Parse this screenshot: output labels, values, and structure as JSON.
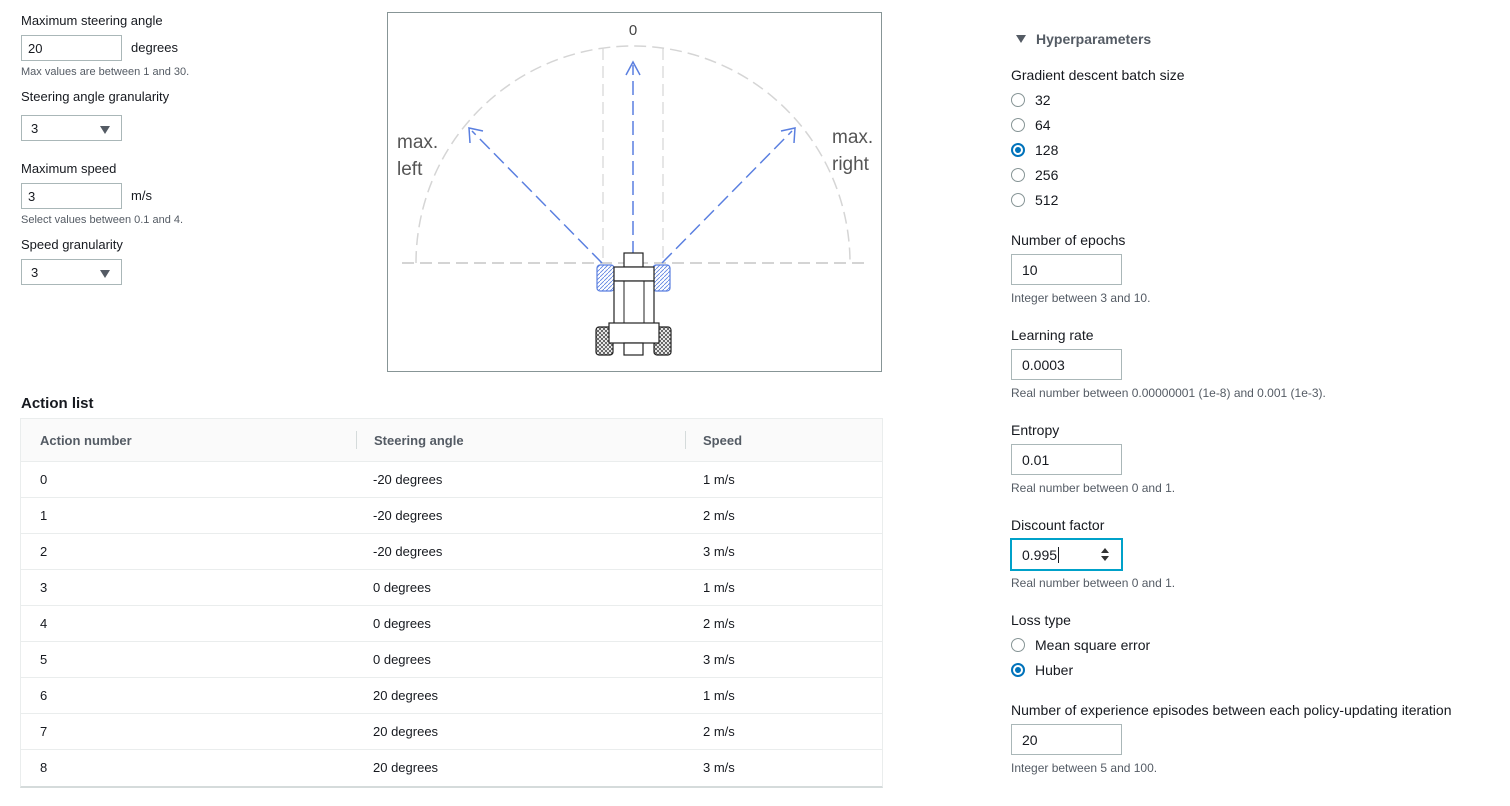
{
  "left_panel": {
    "max_steering_label": "Maximum steering angle",
    "max_steering_value": "20",
    "max_steering_unit": "degrees",
    "max_steering_hint": "Max values are between 1 and 30.",
    "steering_granularity_label": "Steering angle granularity",
    "steering_granularity_value": "3",
    "max_speed_label": "Maximum speed",
    "max_speed_value": "3",
    "max_speed_unit": "m/s",
    "max_speed_hint": "Select values between 0.1 and 4.",
    "speed_granularity_label": "Speed granularity",
    "speed_granularity_value": "3"
  },
  "diagram": {
    "top_label": "0",
    "left_label_1": "max.",
    "left_label_2": "left",
    "right_label_1": "max.",
    "right_label_2": "right",
    "arrow_color": "#5a7fe0"
  },
  "action_list": {
    "title": "Action list",
    "columns": [
      "Action number",
      "Steering angle",
      "Speed"
    ],
    "rows": [
      {
        "num": "0",
        "angle": "-20 degrees",
        "speed": "1 m/s"
      },
      {
        "num": "1",
        "angle": "-20 degrees",
        "speed": "2 m/s"
      },
      {
        "num": "2",
        "angle": "-20 degrees",
        "speed": "3 m/s"
      },
      {
        "num": "3",
        "angle": "0 degrees",
        "speed": "1 m/s"
      },
      {
        "num": "4",
        "angle": "0 degrees",
        "speed": "2 m/s"
      },
      {
        "num": "5",
        "angle": "0 degrees",
        "speed": "3 m/s"
      },
      {
        "num": "6",
        "angle": "20 degrees",
        "speed": "1 m/s"
      },
      {
        "num": "7",
        "angle": "20 degrees",
        "speed": "2 m/s"
      },
      {
        "num": "8",
        "angle": "20 degrees",
        "speed": "3 m/s"
      }
    ]
  },
  "hyperparameters": {
    "title": "Hyperparameters",
    "batch_size_label": "Gradient descent batch size",
    "batch_sizes": [
      "32",
      "64",
      "128",
      "256",
      "512"
    ],
    "batch_size_selected": "128",
    "epochs_label": "Number of epochs",
    "epochs_value": "10",
    "epochs_hint": "Integer between 3 and 10.",
    "lr_label": "Learning rate",
    "lr_value": "0.0003",
    "lr_hint": "Real number between 0.00000001 (1e-8) and 0.001 (1e-3).",
    "entropy_label": "Entropy",
    "entropy_value": "0.01",
    "entropy_hint": "Real number between 0 and 1.",
    "discount_label": "Discount factor",
    "discount_value": "0.995",
    "discount_hint": "Real number between 0 and 1.",
    "loss_label": "Loss type",
    "loss_options": [
      "Mean square error",
      "Huber"
    ],
    "loss_selected": "Huber",
    "episodes_label": "Number of experience episodes between each policy-updating iteration",
    "episodes_value": "20",
    "episodes_hint": "Integer between 5 and 100."
  },
  "colors": {
    "accent": "#0073bb",
    "focus": "#00a1c9",
    "text": "#16191f",
    "muted": "#545b64"
  }
}
